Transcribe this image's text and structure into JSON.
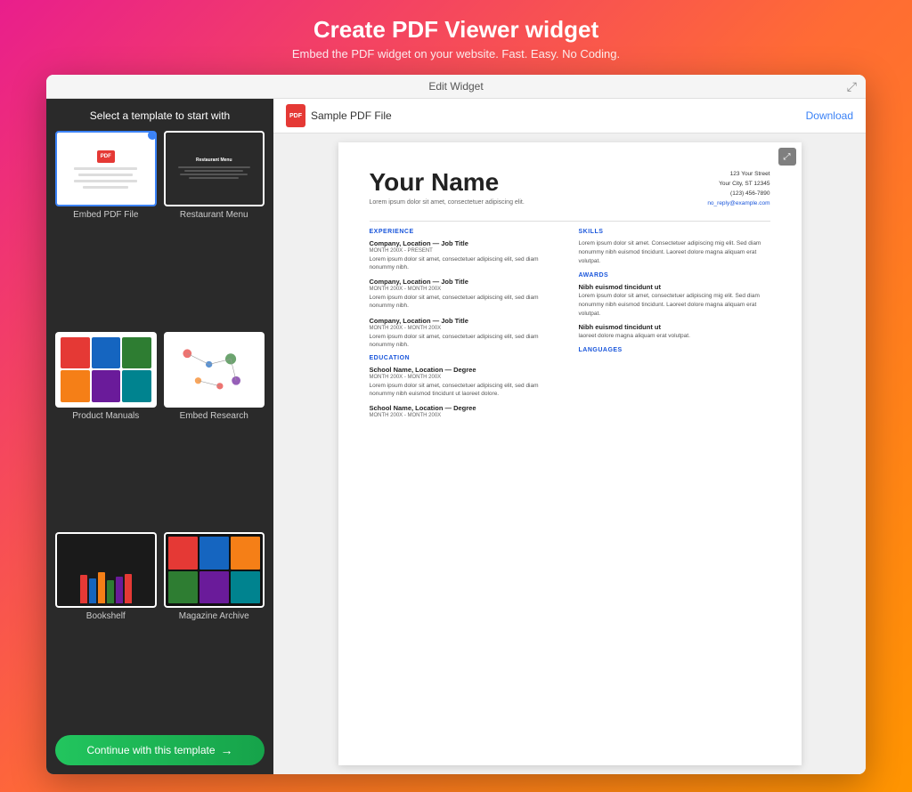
{
  "header": {
    "title": "Create PDF Viewer widget",
    "subtitle": "Embed the PDF widget on your website. Fast. Easy. No Coding."
  },
  "window": {
    "title": "Edit Widget",
    "expand_icon": "⤢"
  },
  "left_panel": {
    "label": "Select a template to start with",
    "templates": [
      {
        "id": "embed-pdf",
        "name": "Embed PDF File",
        "selected": true
      },
      {
        "id": "restaurant-menu",
        "name": "Restaurant Menu",
        "selected": false
      },
      {
        "id": "product-manuals",
        "name": "Product Manuals",
        "selected": false
      },
      {
        "id": "embed-research",
        "name": "Embed Research",
        "selected": false
      },
      {
        "id": "bookshelf",
        "name": "Bookshelf",
        "selected": false
      },
      {
        "id": "magazine-archive",
        "name": "Magazine Archive",
        "selected": false
      }
    ],
    "continue_button": "Continue with this template"
  },
  "pdf_toolbar": {
    "filename": "Sample PDF File",
    "download_label": "Download"
  },
  "pdf_content": {
    "name": "Your Name",
    "tagline": "Lorem ipsum dolor sit amet, consectetuer adipiscing elit.",
    "address": "123 Your Street",
    "city_state": "Your City, ST 12345",
    "phone": "(123) 456-7890",
    "email": "no_reply@example.com",
    "experience_label": "EXPERIENCE",
    "jobs": [
      {
        "title": "Company, Location — Job Title",
        "date": "MONTH 200X - PRESENT",
        "desc": "Lorem ipsum dolor sit amet, consectetuer adipiscing elit, sed diam nonummy nibh."
      },
      {
        "title": "Company, Location — Job Title",
        "date": "MONTH 200X - MONTH 200X",
        "desc": "Lorem ipsum dolor sit amet, consectetuer adipiscing elit, sed diam nonummy nibh."
      },
      {
        "title": "Company, Location — Job Title",
        "date": "MONTH 200X - MONTH 200X",
        "desc": "Lorem ipsum dolor sit amet, consectetuer adipiscing elit, sed diam nonummy nibh."
      }
    ],
    "education_label": "EDUCATION",
    "schools": [
      {
        "title": "School Name, Location — Degree",
        "date": "MONTH 200X - MONTH 200X",
        "desc": "Lorem ipsum dolor sit amet, consectetuer adipiscing elit, sed diam nonummy nibh euismod tincidunt ut laoreet dolore."
      },
      {
        "title": "School Name, Location — Degree",
        "date": "MONTH 200X - MONTH 200X",
        "desc": ""
      }
    ],
    "skills_label": "SKILLS",
    "skills_text": "Lorem ipsum dolor sit amet. Consectetuer adipiscing mig elit. Sed diam nonummy nibh euismod tincidunt. Laoreet dolore magna aliquam erat volutpat.",
    "awards_label": "AWARDS",
    "awards": [
      {
        "title": "Nibh euismod tincidunt ut",
        "desc": "Lorem ipsum dolor sit amet, consectetuer adipiscing mig elit. Sed diam nonummy nibh euismod tincidunt. Laoreet dolore magna aliquam erat volutpat."
      },
      {
        "title": "Nibh euismod tincidunt ut",
        "desc": "laoreet dolore magna aliquam erat volutpat."
      }
    ],
    "languages_label": "LANGUAGES"
  },
  "icons": {
    "pdf": "PDF",
    "expand": "⤢",
    "arrow_right": "→"
  }
}
